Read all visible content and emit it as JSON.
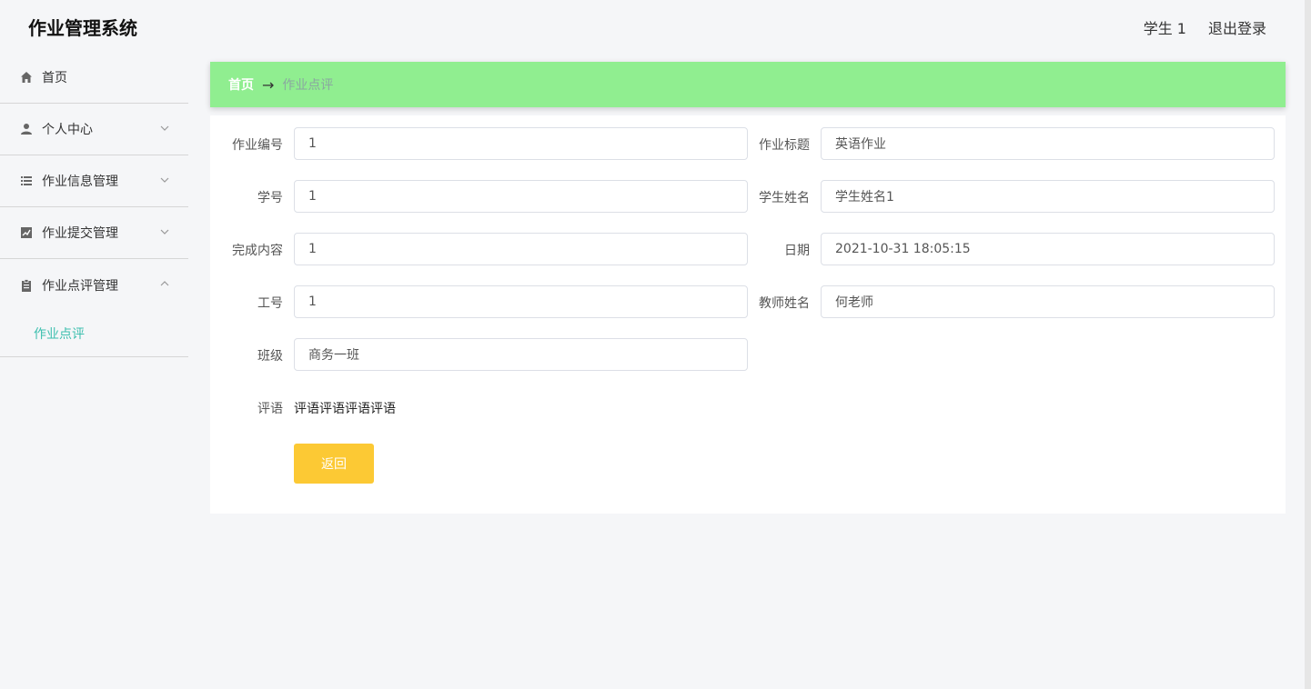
{
  "app": {
    "title": "作业管理系统"
  },
  "header": {
    "user": "学生 1",
    "logout": "退出登录"
  },
  "sidebar": {
    "items": [
      {
        "label": "首页",
        "icon": "home-icon"
      },
      {
        "label": "个人中心",
        "icon": "user-icon"
      },
      {
        "label": "作业信息管理",
        "icon": "list-icon"
      },
      {
        "label": "作业提交管理",
        "icon": "chart-icon"
      },
      {
        "label": "作业点评管理",
        "icon": "clipboard-icon",
        "expanded": true,
        "children": [
          {
            "label": "作业点评",
            "active": true
          }
        ]
      }
    ]
  },
  "breadcrumb": {
    "home": "首页",
    "separator": "→",
    "current": "作业点评"
  },
  "form": {
    "homework_id": {
      "label": "作业编号",
      "value": "1"
    },
    "homework_title": {
      "label": "作业标题",
      "value": "英语作业"
    },
    "student_id": {
      "label": "学号",
      "value": "1"
    },
    "student_name": {
      "label": "学生姓名",
      "value": "学生姓名1"
    },
    "content": {
      "label": "完成内容",
      "value": "1"
    },
    "date": {
      "label": "日期",
      "value": "2021-10-31 18:05:15"
    },
    "teacher_id": {
      "label": "工号",
      "value": "1"
    },
    "teacher_name": {
      "label": "教师姓名",
      "value": "何老师"
    },
    "class": {
      "label": "班级",
      "value": "商务一班"
    },
    "comment": {
      "label": "评语",
      "value": "评语评语评语评语"
    },
    "back_label": "返回"
  },
  "colors": {
    "breadcrumb_bg": "#90ee90",
    "active_submenu": "#3cbfae",
    "back_button": "#fcc934"
  }
}
